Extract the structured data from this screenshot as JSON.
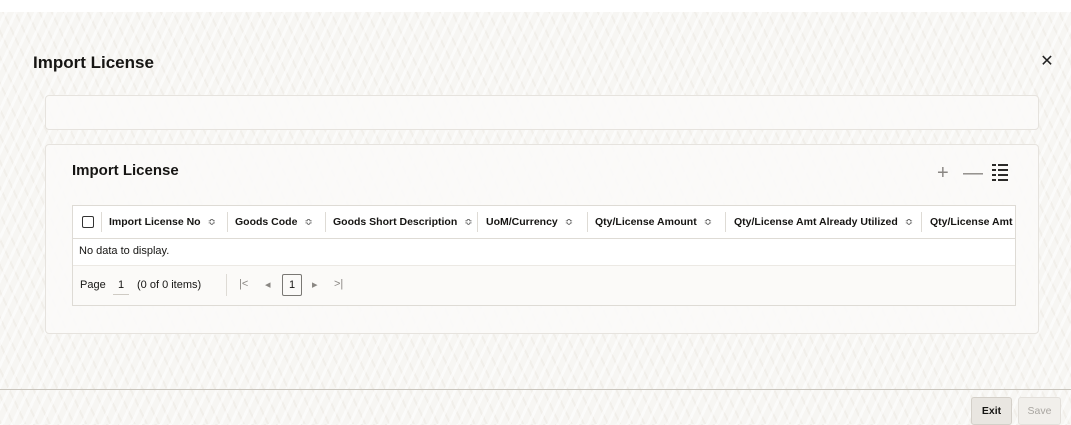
{
  "dialog": {
    "title": "Import License",
    "close_glyph": "✕"
  },
  "section": {
    "title": "Import License",
    "toolbar": {
      "add_glyph": "+",
      "remove_glyph": "—"
    }
  },
  "grid": {
    "columns": [
      "Import License No",
      "Goods Code",
      "Goods Short Description",
      "UoM/Currency",
      "Qty/License Amount",
      "Qty/License Amt Already Utilized",
      "Qty/License Amt A"
    ],
    "sort_glyph": "≎",
    "empty_message": "No data to display."
  },
  "pager": {
    "page_label": "Page",
    "page_value": "1",
    "items_summary": "(0 of 0 items)",
    "first_glyph": "|<",
    "prev_glyph": "◂",
    "current_page": "1",
    "next_glyph": "▸",
    "last_glyph": ">|"
  },
  "footer": {
    "exit_label": "Exit",
    "save_label": "Save"
  },
  "icons": {
    "close": "close-icon",
    "add": "plus-icon",
    "remove": "minus-icon",
    "columns": "column-list-icon",
    "sort": "sort-icon"
  }
}
